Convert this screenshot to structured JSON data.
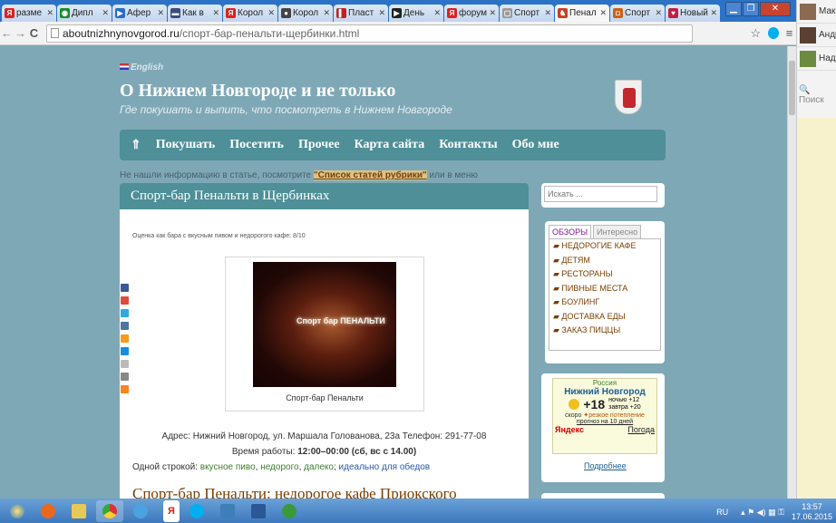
{
  "browser": {
    "tabs": [
      {
        "label": "разме",
        "fav_color": "#e02020",
        "fav": "Я"
      },
      {
        "label": "Дипл",
        "fav_color": "#1b8a2b",
        "fav": "◉"
      },
      {
        "label": "Афер",
        "fav_color": "#2a6cc4",
        "fav": "▶"
      },
      {
        "label": "Как в",
        "fav_color": "#3a4c7a",
        "fav": "▬"
      },
      {
        "label": "Корол",
        "fav_color": "#e02020",
        "fav": "Я"
      },
      {
        "label": "Корол",
        "fav_color": "#444444",
        "fav": "●"
      },
      {
        "label": "Пласт",
        "fav_color": "#c02020",
        "fav": "▌"
      },
      {
        "label": "День",
        "fav_color": "#222222",
        "fav": "▶"
      },
      {
        "label": "форум",
        "fav_color": "#e02020",
        "fav": "Я"
      },
      {
        "label": "Спорт",
        "fav_color": "#999999",
        "fav": "▢"
      },
      {
        "label": "Пенал",
        "fav_color": "#c94020",
        "fav": "♞",
        "active": true
      },
      {
        "label": "Спорт",
        "fav_color": "#d06010",
        "fav": "◘"
      },
      {
        "label": "Новый",
        "fav_color": "#c02040",
        "fav": "♥"
      }
    ],
    "window_buttons": [
      "▁",
      "❐",
      "✕"
    ],
    "url_host": "aboutnizhnynovgorod.ru",
    "url_path": "/спорт-бар-пенальти-щербинки.html",
    "back": "←",
    "forward": "→",
    "reload": "C",
    "star": "☆",
    "menu": "≡"
  },
  "side_panel": {
    "contacts": [
      "Мак",
      "Андр",
      "Над"
    ],
    "search": "Поиск"
  },
  "site": {
    "lang": "English",
    "title": "О Нижнем Новгороде и не только",
    "subtitle": "Где покушать и выпить, что посмотреть в Нижнем Новгороде",
    "menu": {
      "home": "⇑",
      "items": [
        "Покушать",
        "Посетить",
        "Прочее",
        "Карта сайта",
        "Контакты",
        "Обо мне"
      ]
    },
    "notice_pre": "Не нашли информацию в статье, посмотрите ",
    "notice_link": "\"Список статей рубрики\"",
    "notice_post": " или в меню"
  },
  "article": {
    "title": "Спорт-бар Пенальти в Щербинках",
    "rating": "Оценка как бара с вкусным пивом и недорогого кафе: 8/10",
    "photo_sign": "Спорт бар ПЕНАЛЬТИ",
    "caption": "Спорт-бар Пенальти",
    "address": "Адрес: Нижний Новгород, ул. Маршала Голованова, 23а Телефон: 291-77-08",
    "hours_label": "Время работы: ",
    "hours_value": "12:00–00:00 (сб, вс с 14.00)",
    "oneline_label": "Одной строкой: ",
    "tags_green": [
      "вкусное пиво",
      "недорого",
      "далеко"
    ],
    "tag_blue": "идеально для обедов",
    "title2": "Спорт-бар Пенальти: недорогое кафе Приокского"
  },
  "sidebar": {
    "search_placeholder": "Искать ...",
    "tabs": [
      "ОБЗОРЫ",
      "Интересно"
    ],
    "categories": [
      "НЕДОРОГИЕ КАФЕ",
      "ДЕТЯМ",
      "РЕСТОРАНЫ",
      "ПИВНЫЕ МЕСТА",
      "БОУЛИНГ",
      "ДОСТАВКА ЕДЫ",
      "ЗАКАЗ ПИЦЦЫ"
    ],
    "weather": {
      "region": "Россия",
      "city": "Нижний Новгород",
      "temp": "+18",
      "night": "ночью +12",
      "tomorrow": "завтра +20",
      "warn_pre": "скоро ",
      "warn": "резкое потепление",
      "forecast": "прогноз на 10 дней",
      "brand": "Яндекс",
      "pogoda": "Погода"
    },
    "more": "Подробнее"
  },
  "taskbar": {
    "lang": "RU",
    "time": "13:57",
    "date": "17.06.2015"
  }
}
